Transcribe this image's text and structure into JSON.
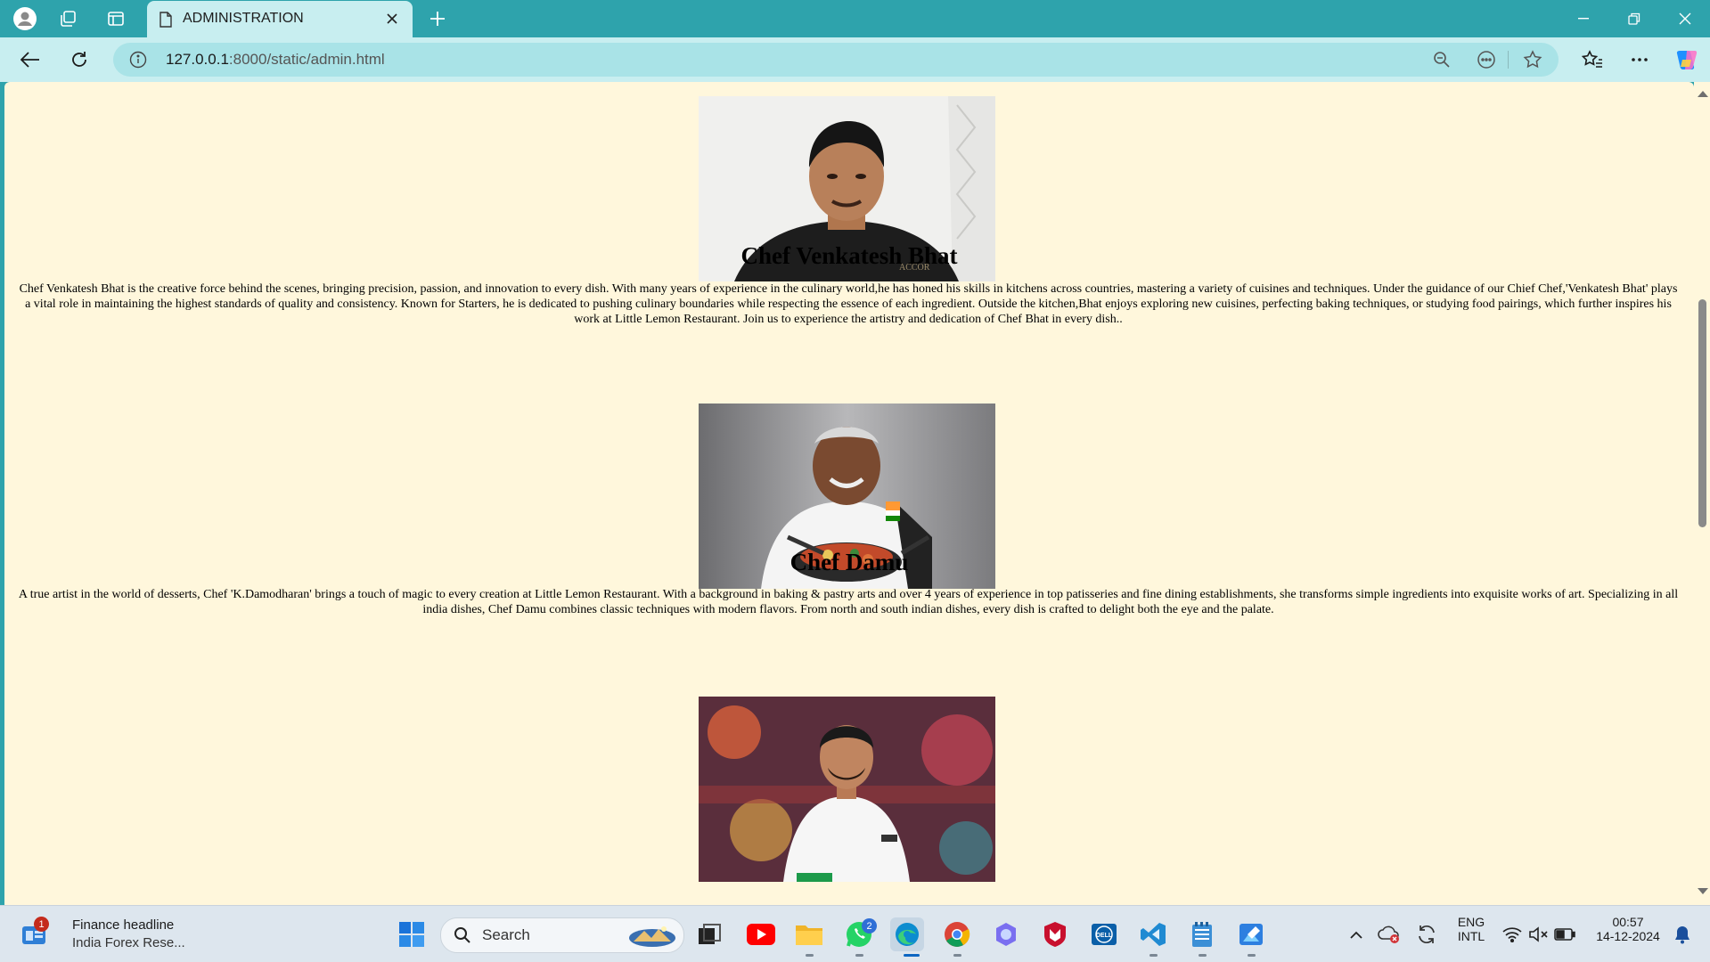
{
  "browser": {
    "tab_title": "ADMINISTRATION",
    "url_host": "127.0.0.1",
    "url_path": ":8000/static/admin.html"
  },
  "page": {
    "chefs": [
      {
        "image_alt": "Photo of Chef Venkatesh Bhat in black chef coat",
        "name": "Chef Venkatesh Bhat",
        "bio": "Chef Venkatesh Bhat is the creative force behind the scenes, bringing precision, passion, and innovation to every dish. With many years of experience in the culinary world,he has honed his skills in kitchens across countries, mastering a variety of cuisines and techniques. Under the guidance of our Chief Chef,'Venkatesh Bhat' plays a vital role in maintaining the highest standards of quality and consistency. Known for Starters, he is dedicated to pushing culinary boundaries while respecting the essence of each ingredient. Outside the kitchen,Bhat enjoys exploring new cuisines, perfecting baking techniques, or studying food pairings, which further inspires his work at Little Lemon Restaurant. Join us to experience the artistry and dedication of Chef Bhat in every dish.."
      },
      {
        "image_alt": "Photo of Chef Damu holding a pan",
        "name": "Chef Damu",
        "bio": "A true artist in the world of desserts, Chef 'K.Damodharan' brings a touch of magic to every creation at Little Lemon Restaurant. With a background in baking & pastry arts and over 4 years of experience in top patisseries and fine dining establishments, she transforms simple ingredients into exquisite works of art. Specializing in all india dishes, Chef Damu combines classic techniques with modern flavors. From north and south indian dishes, every dish is crafted to delight both the eye and the palate."
      },
      {
        "image_alt": "Photo of a chef in white coat",
        "name": "",
        "bio": ""
      }
    ]
  },
  "taskbar": {
    "news_badge": "1",
    "news_title": "Finance headline",
    "news_subtitle": "India Forex Rese...",
    "search_label": "Search",
    "whatsapp_badge": "2",
    "lang_line1": "ENG",
    "lang_line2": "INTL",
    "time": "00:57",
    "date": "14-12-2024"
  },
  "colors": {
    "browser_frame": "#2ea3ac",
    "toolbar": "#c8eef0",
    "page_background": "#fff7dc"
  }
}
